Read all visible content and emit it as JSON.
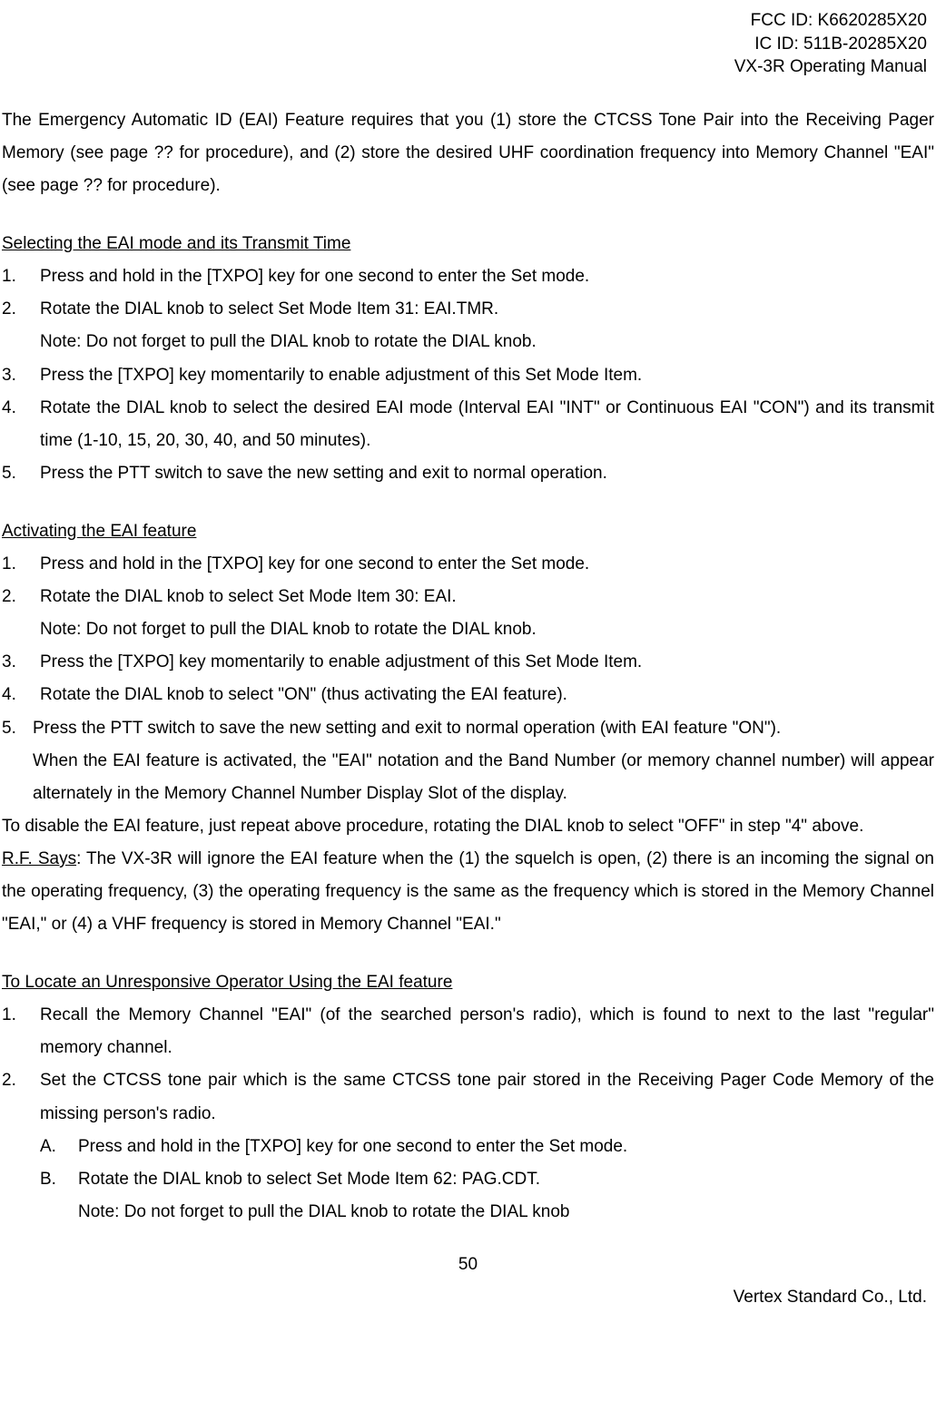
{
  "header": {
    "fcc": "FCC ID: K6620285X20",
    "ic": "IC ID: 511B-20285X20",
    "manual": "VX-3R Operating Manual"
  },
  "intro": "The Emergency Automatic ID (EAI) Feature requires that you (1) store the CTCSS Tone Pair into the Receiving Pager Memory (see page ?? for procedure), and (2) store the desired UHF coordination frequency into Memory Channel \"EAI\" (see page ?? for procedure).",
  "section1": {
    "title": "Selecting the EAI mode and its Transmit Time",
    "items": [
      {
        "n": "1.",
        "t": "Press and hold in the [TXPO] key for one second to enter the Set mode."
      },
      {
        "n": "2.",
        "t": "Rotate the DIAL knob to select Set Mode Item 31: EAI.TMR.",
        "note": "Note: Do not forget to pull the DIAL knob to rotate the DIAL knob."
      },
      {
        "n": "3.",
        "t": "Press the [TXPO] key momentarily to enable adjustment of this Set Mode Item."
      },
      {
        "n": "4.",
        "t": "Rotate the DIAL knob to select the desired EAI mode (Interval EAI \"INT\" or Continuous EAI \"CON\") and its transmit time (1-10, 15, 20, 30, 40, and 50 minutes)."
      },
      {
        "n": "5.",
        "t": "Press the PTT switch to save the new setting and exit to normal operation."
      }
    ]
  },
  "section2": {
    "title": "Activating the EAI feature",
    "items": [
      {
        "n": "1.",
        "t": "Press and hold in the [TXPO] key for one second to enter the Set mode."
      },
      {
        "n": "2.",
        "t": "Rotate the DIAL knob to select Set Mode Item 30: EAI.",
        "note": "Note: Do not forget to pull the DIAL knob to rotate the DIAL knob."
      },
      {
        "n": "3.",
        "t": "Press the [TXPO] key momentarily to enable adjustment of this Set Mode Item."
      },
      {
        "n": "4.",
        "t": "Rotate the DIAL knob to select \"ON\" (thus activating the EAI feature)."
      }
    ],
    "item5": {
      "n": "5.",
      "first": "Press the PTT switch to save the new setting and exit to normal operation (with EAI feature \"ON\").",
      "rest": "When the EAI feature is activated, the \"EAI\" notation and the Band Number (or memory channel number) will appear alternately in the Memory Channel Number Display Slot of the display."
    },
    "disable": "To disable the EAI feature, just repeat above procedure, rotating the DIAL knob to select \"OFF\" in step \"4\" above.",
    "rf_label": "R.F. Says",
    "rf_text": ": The VX-3R will ignore the EAI feature when the (1) the squelch is open, (2) there is an incoming the signal on the operating frequency, (3) the operating frequency is the same as the frequency which is stored in the Memory Channel \"EAI,\" or (4) a VHF frequency is stored in Memory Channel \"EAI.\""
  },
  "section3": {
    "title": "To Locate an Unresponsive Operator Using the EAI feature",
    "items": [
      {
        "n": "1.",
        "t": "Recall the Memory Channel \"EAI\" (of the searched person's radio), which is found to next to the last \"regular\" memory channel."
      },
      {
        "n": "2.",
        "t": "Set the CTCSS tone pair which is the same CTCSS tone pair stored in the Receiving Pager Code Memory of the missing person's radio."
      }
    ],
    "subs": [
      {
        "n": "A.",
        "t": "Press and hold in the [TXPO] key for one second to enter the Set mode."
      },
      {
        "n": "B.",
        "t": "Rotate the DIAL knob to select Set Mode Item 62: PAG.CDT.",
        "note": "Note: Do not forget to pull the DIAL knob to rotate the DIAL knob"
      }
    ]
  },
  "footer": {
    "page": "50",
    "company": "Vertex Standard Co., Ltd."
  }
}
